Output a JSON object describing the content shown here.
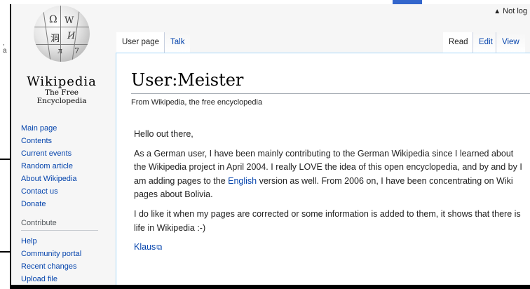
{
  "background": {
    "fragment": ", a"
  },
  "personal": {
    "label": "Not log"
  },
  "logo": {
    "wordmark": "Wikipedia",
    "tagline": "The Free Encyclopedia"
  },
  "nav": {
    "main": [
      "Main page",
      "Contents",
      "Current events",
      "Random article",
      "About Wikipedia",
      "Contact us",
      "Donate"
    ],
    "contribute_heading": "Contribute",
    "contribute": [
      "Help",
      "Community portal",
      "Recent changes",
      "Upload file"
    ]
  },
  "tabs": {
    "user_page": "User page",
    "talk": "Talk",
    "read": "Read",
    "edit": "Edit",
    "view": "View"
  },
  "article": {
    "title": "User:Meister",
    "subtitle": "From Wikipedia, the free encyclopedia",
    "greeting": "Hello out there,",
    "p1_before": "As a German user, I have been mainly contributing to the German Wikipedia since I learned about the Wikipedia project in April 2004. I really LOVE the idea of this open encyclopedia, and by and by I am adding pages to the ",
    "p1_link": "English",
    "p1_after": " version as well. From 2006 on, I have been concentrating on Wiki pages about Bolivia.",
    "p2": "I do like it when my pages are corrected or some information is added to them, it shows that there is life in Wikipedia :-)",
    "signature_link": "Klaus"
  },
  "colors": {
    "link": "#0645ad",
    "content_border": "#a7d7f9",
    "sidebar_bg": "#f6f6f6"
  }
}
